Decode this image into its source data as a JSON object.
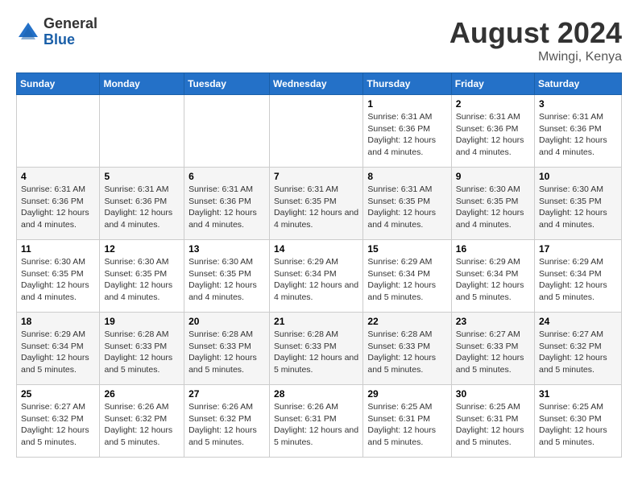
{
  "header": {
    "logo_line1": "General",
    "logo_line2": "Blue",
    "month_year": "August 2024",
    "location": "Mwingi, Kenya"
  },
  "days_of_week": [
    "Sunday",
    "Monday",
    "Tuesday",
    "Wednesday",
    "Thursday",
    "Friday",
    "Saturday"
  ],
  "weeks": [
    [
      {
        "day": "",
        "info": ""
      },
      {
        "day": "",
        "info": ""
      },
      {
        "day": "",
        "info": ""
      },
      {
        "day": "",
        "info": ""
      },
      {
        "day": "1",
        "info": "Sunrise: 6:31 AM\nSunset: 6:36 PM\nDaylight: 12 hours and 4 minutes."
      },
      {
        "day": "2",
        "info": "Sunrise: 6:31 AM\nSunset: 6:36 PM\nDaylight: 12 hours and 4 minutes."
      },
      {
        "day": "3",
        "info": "Sunrise: 6:31 AM\nSunset: 6:36 PM\nDaylight: 12 hours and 4 minutes."
      }
    ],
    [
      {
        "day": "4",
        "info": "Sunrise: 6:31 AM\nSunset: 6:36 PM\nDaylight: 12 hours and 4 minutes."
      },
      {
        "day": "5",
        "info": "Sunrise: 6:31 AM\nSunset: 6:36 PM\nDaylight: 12 hours and 4 minutes."
      },
      {
        "day": "6",
        "info": "Sunrise: 6:31 AM\nSunset: 6:36 PM\nDaylight: 12 hours and 4 minutes."
      },
      {
        "day": "7",
        "info": "Sunrise: 6:31 AM\nSunset: 6:35 PM\nDaylight: 12 hours and 4 minutes."
      },
      {
        "day": "8",
        "info": "Sunrise: 6:31 AM\nSunset: 6:35 PM\nDaylight: 12 hours and 4 minutes."
      },
      {
        "day": "9",
        "info": "Sunrise: 6:30 AM\nSunset: 6:35 PM\nDaylight: 12 hours and 4 minutes."
      },
      {
        "day": "10",
        "info": "Sunrise: 6:30 AM\nSunset: 6:35 PM\nDaylight: 12 hours and 4 minutes."
      }
    ],
    [
      {
        "day": "11",
        "info": "Sunrise: 6:30 AM\nSunset: 6:35 PM\nDaylight: 12 hours and 4 minutes."
      },
      {
        "day": "12",
        "info": "Sunrise: 6:30 AM\nSunset: 6:35 PM\nDaylight: 12 hours and 4 minutes."
      },
      {
        "day": "13",
        "info": "Sunrise: 6:30 AM\nSunset: 6:35 PM\nDaylight: 12 hours and 4 minutes."
      },
      {
        "day": "14",
        "info": "Sunrise: 6:29 AM\nSunset: 6:34 PM\nDaylight: 12 hours and 4 minutes."
      },
      {
        "day": "15",
        "info": "Sunrise: 6:29 AM\nSunset: 6:34 PM\nDaylight: 12 hours and 5 minutes."
      },
      {
        "day": "16",
        "info": "Sunrise: 6:29 AM\nSunset: 6:34 PM\nDaylight: 12 hours and 5 minutes."
      },
      {
        "day": "17",
        "info": "Sunrise: 6:29 AM\nSunset: 6:34 PM\nDaylight: 12 hours and 5 minutes."
      }
    ],
    [
      {
        "day": "18",
        "info": "Sunrise: 6:29 AM\nSunset: 6:34 PM\nDaylight: 12 hours and 5 minutes."
      },
      {
        "day": "19",
        "info": "Sunrise: 6:28 AM\nSunset: 6:33 PM\nDaylight: 12 hours and 5 minutes."
      },
      {
        "day": "20",
        "info": "Sunrise: 6:28 AM\nSunset: 6:33 PM\nDaylight: 12 hours and 5 minutes."
      },
      {
        "day": "21",
        "info": "Sunrise: 6:28 AM\nSunset: 6:33 PM\nDaylight: 12 hours and 5 minutes."
      },
      {
        "day": "22",
        "info": "Sunrise: 6:28 AM\nSunset: 6:33 PM\nDaylight: 12 hours and 5 minutes."
      },
      {
        "day": "23",
        "info": "Sunrise: 6:27 AM\nSunset: 6:33 PM\nDaylight: 12 hours and 5 minutes."
      },
      {
        "day": "24",
        "info": "Sunrise: 6:27 AM\nSunset: 6:32 PM\nDaylight: 12 hours and 5 minutes."
      }
    ],
    [
      {
        "day": "25",
        "info": "Sunrise: 6:27 AM\nSunset: 6:32 PM\nDaylight: 12 hours and 5 minutes."
      },
      {
        "day": "26",
        "info": "Sunrise: 6:26 AM\nSunset: 6:32 PM\nDaylight: 12 hours and 5 minutes."
      },
      {
        "day": "27",
        "info": "Sunrise: 6:26 AM\nSunset: 6:32 PM\nDaylight: 12 hours and 5 minutes."
      },
      {
        "day": "28",
        "info": "Sunrise: 6:26 AM\nSunset: 6:31 PM\nDaylight: 12 hours and 5 minutes."
      },
      {
        "day": "29",
        "info": "Sunrise: 6:25 AM\nSunset: 6:31 PM\nDaylight: 12 hours and 5 minutes."
      },
      {
        "day": "30",
        "info": "Sunrise: 6:25 AM\nSunset: 6:31 PM\nDaylight: 12 hours and 5 minutes."
      },
      {
        "day": "31",
        "info": "Sunrise: 6:25 AM\nSunset: 6:30 PM\nDaylight: 12 hours and 5 minutes."
      }
    ]
  ]
}
